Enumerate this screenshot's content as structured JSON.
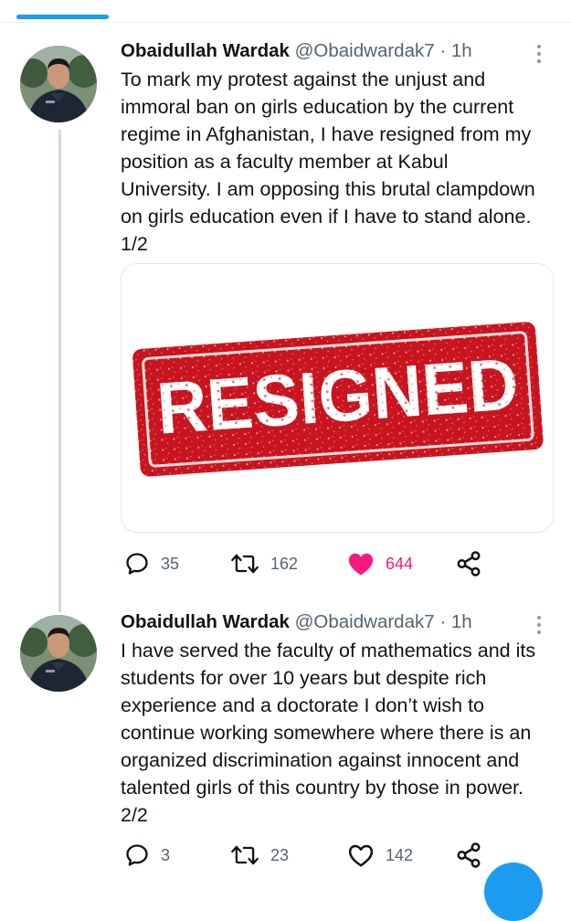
{
  "tweets": [
    {
      "author": "Obaidullah Wardak",
      "handle": "@Obaidwardak7",
      "separator": "·",
      "time": "1h",
      "text": "To mark my protest against the unjust and\nimmoral ban on girls education by the current\nregime in Afghanistan, I have resigned from my\nposition as a faculty member at Kabul\nUniversity. I am opposing this brutal clampdown\non girls education even if I have to stand alone.\n1/2",
      "media_stamp": "RESIGNED",
      "replies": "35",
      "retweets": "162",
      "likes": "644",
      "liked": true
    },
    {
      "author": "Obaidullah Wardak",
      "handle": "@Obaidwardak7",
      "separator": "·",
      "time": "1h",
      "text": "I have served the faculty of mathematics and its\nstudents for over 10 years but despite rich\nexperience and a doctorate I don’t wish to\ncontinue working somewhere where there is an\norganized discrimination against innocent and\ntalented girls of this country by those in power.\n2/2",
      "replies": "3",
      "retweets": "23",
      "likes": "142",
      "liked": false
    }
  ],
  "colors": {
    "accent": "#1d9bf0",
    "like": "#f91880",
    "stamp": "#c8141e",
    "text": "#0f1419",
    "secondary": "#536471"
  },
  "icons": [
    "more-icon",
    "reply-icon",
    "retweet-icon",
    "like-icon",
    "share-icon"
  ]
}
